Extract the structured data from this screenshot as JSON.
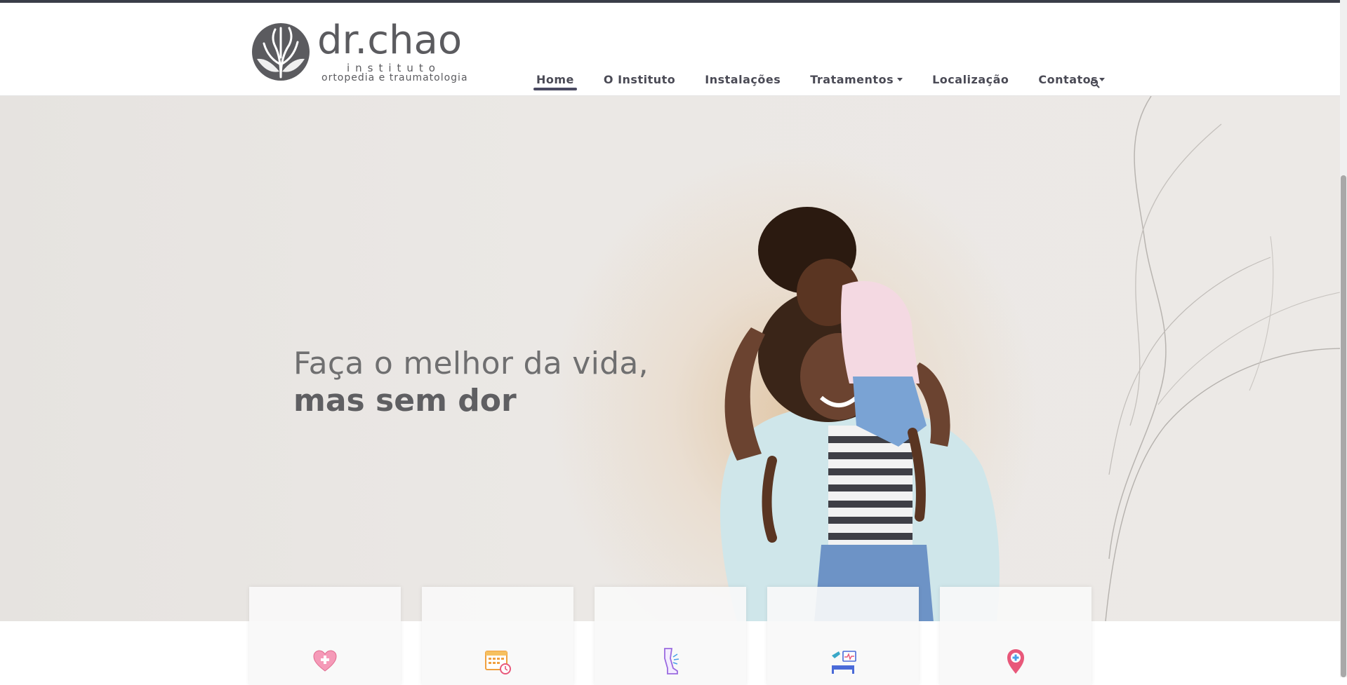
{
  "brand": {
    "name": "dr.chao",
    "line1": "instituto",
    "line2": "ortopedia e traumatologia"
  },
  "nav": {
    "items": [
      {
        "label": "Home",
        "active": true
      },
      {
        "label": "O Instituto"
      },
      {
        "label": "Instalações"
      },
      {
        "label": "Tratamentos",
        "has_dropdown": true
      },
      {
        "label": "Localização"
      },
      {
        "label": "Contatos",
        "has_dropdown": true
      }
    ],
    "search_icon": "search-icon"
  },
  "hero": {
    "headline_line1": "Faça o melhor da vida,",
    "headline_line2": "mas sem dor"
  },
  "cards": [
    {
      "icon": "heart-plus-icon"
    },
    {
      "icon": "calendar-clock-icon"
    },
    {
      "icon": "leg-injury-icon"
    },
    {
      "icon": "medical-bed-icon"
    },
    {
      "icon": "location-pin-icon"
    }
  ],
  "colors": {
    "text_dark": "#4a4a55",
    "hero_bg": "#ebe8e5",
    "whatsapp": "#25d366",
    "topbar": "#3a3d48"
  }
}
